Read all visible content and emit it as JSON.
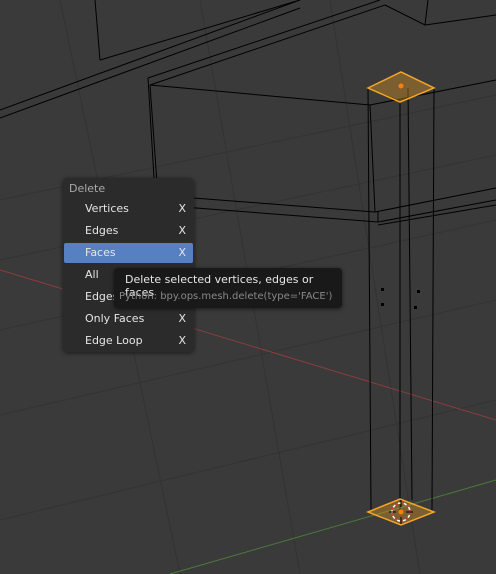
{
  "menu": {
    "title": "Delete",
    "items": [
      {
        "label": "Vertices",
        "shortcut": "X",
        "selected": false
      },
      {
        "label": "Edges",
        "shortcut": "X",
        "selected": false
      },
      {
        "label": "Faces",
        "shortcut": "X",
        "selected": true
      },
      {
        "label": "All",
        "shortcut": "",
        "selected": false
      },
      {
        "label": "Edges",
        "shortcut": "",
        "selected": false
      },
      {
        "label": "Only Faces",
        "shortcut": "X",
        "selected": false
      },
      {
        "label": "Edge Loop",
        "shortcut": "X",
        "selected": false
      }
    ]
  },
  "tooltip": {
    "description": "Delete selected vertices, edges or faces",
    "python": "Python: bpy.ops.mesh.delete(type='FACE')"
  },
  "colors": {
    "viewport_bg": "#3a3a3a",
    "menu_bg": "#2b2b2b",
    "menu_selected": "#5680c2",
    "tooltip_bg": "#191919",
    "selection_orange": "#f5a623",
    "x_axis": "#8a3d3d",
    "y_axis": "#4a7a3a"
  }
}
